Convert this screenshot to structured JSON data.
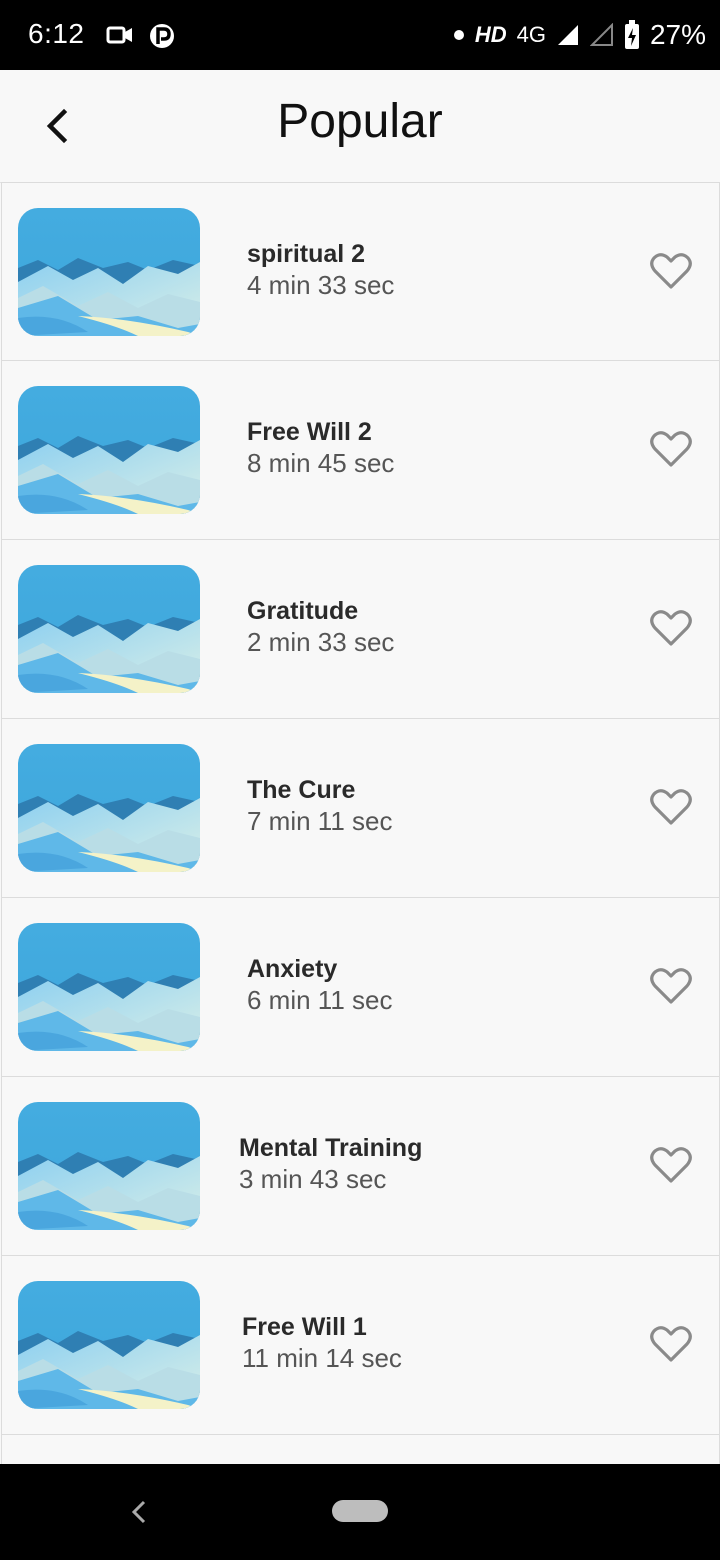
{
  "status_bar": {
    "time": "6:12",
    "network_hd": "HD",
    "network_type": "4G",
    "battery_percent": "27%",
    "icons": [
      "video-camera-icon",
      "parking-icon",
      "dot-icon",
      "signal-icon",
      "signal-empty-icon",
      "battery-charging-icon"
    ]
  },
  "header": {
    "title": "Popular",
    "back_icon": "chevron-left-icon"
  },
  "colors": {
    "sky": "#44ace0",
    "accent_text": "#2a2a2a",
    "heart_outline": "#8a8a8a"
  },
  "items": [
    {
      "title": "spiritual 2",
      "duration": "4 min 33 sec"
    },
    {
      "title": "Free Will 2",
      "duration": "8 min 45 sec"
    },
    {
      "title": "Gratitude",
      "duration": "2 min 33 sec"
    },
    {
      "title": "The Cure",
      "duration": "7 min 11 sec"
    },
    {
      "title": "Anxiety",
      "duration": "6 min 11 sec"
    },
    {
      "title": "Mental Training",
      "duration": "3 min 43 sec"
    },
    {
      "title": "Free Will 1",
      "duration": "11 min 14 sec"
    }
  ],
  "nav_bar": {
    "icons": [
      "back-triangle-icon",
      "home-pill-icon"
    ]
  }
}
